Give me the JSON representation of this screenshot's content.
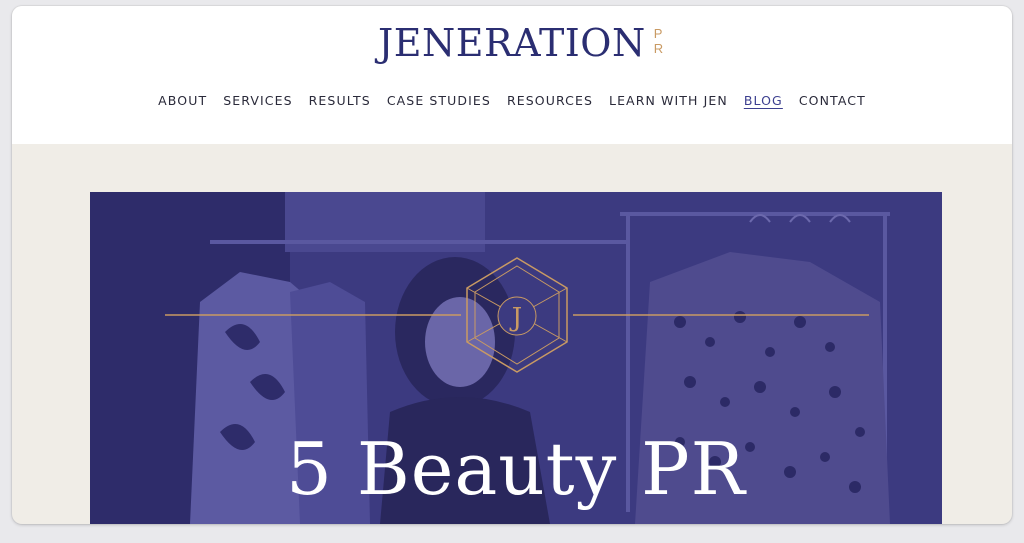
{
  "header": {
    "logo": {
      "main": "JENERATION",
      "sub_top": "P",
      "sub_bottom": "R"
    },
    "nav": [
      {
        "label": "ABOUT"
      },
      {
        "label": "SERVICES"
      },
      {
        "label": "RESULTS"
      },
      {
        "label": "CASE STUDIES"
      },
      {
        "label": "RESOURCES"
      },
      {
        "label": "LEARN WITH JEN"
      },
      {
        "label": "BLOG",
        "active": true
      },
      {
        "label": "CONTACT"
      }
    ]
  },
  "hero": {
    "emblem_letter": "J",
    "title": "5 Beauty PR"
  },
  "colors": {
    "brand_navy": "#2b2e72",
    "gold": "#c99a63",
    "hero_overlay": "#3c3a80",
    "page_bg": "#f0ede7"
  }
}
